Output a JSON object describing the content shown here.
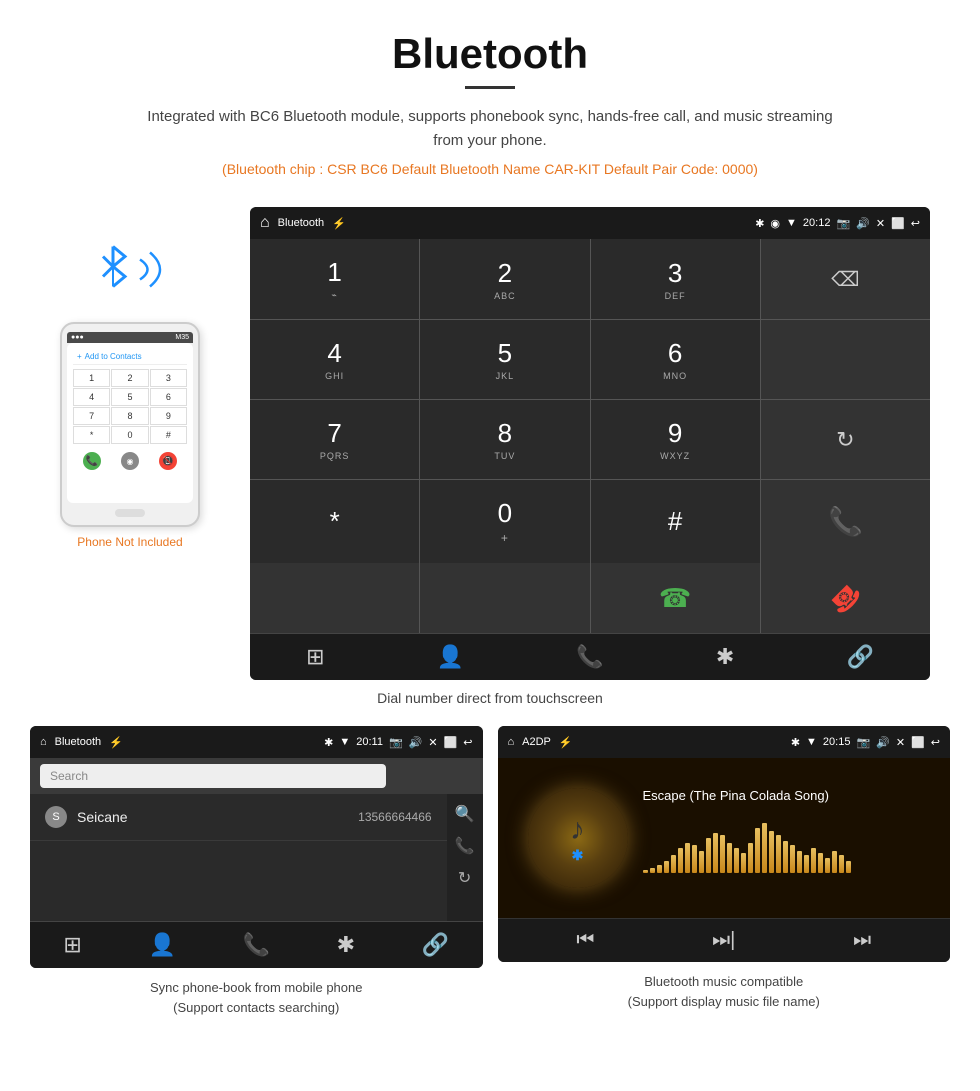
{
  "header": {
    "title": "Bluetooth",
    "subtitle": "Integrated with BC6 Bluetooth module, supports phonebook sync, hands-free call, and music streaming from your phone.",
    "info": "(Bluetooth chip : CSR BC6    Default Bluetooth Name CAR-KIT    Default Pair Code: 0000)"
  },
  "phone_label": "Phone Not Included",
  "dial_screen": {
    "status_bar": {
      "app_name": "Bluetooth",
      "time": "20:12"
    },
    "keys": [
      {
        "num": "1",
        "sub": ""
      },
      {
        "num": "2",
        "sub": "ABC"
      },
      {
        "num": "3",
        "sub": "DEF"
      },
      {
        "num": "",
        "sub": ""
      },
      {
        "num": "4",
        "sub": "GHI"
      },
      {
        "num": "5",
        "sub": "JKL"
      },
      {
        "num": "6",
        "sub": "MNO"
      },
      {
        "num": "",
        "sub": ""
      },
      {
        "num": "7",
        "sub": "PQRS"
      },
      {
        "num": "8",
        "sub": "TUV"
      },
      {
        "num": "9",
        "sub": "WXYZ"
      },
      {
        "num": "",
        "sub": ""
      },
      {
        "num": "*",
        "sub": ""
      },
      {
        "num": "0",
        "sub": "+"
      },
      {
        "num": "#",
        "sub": ""
      },
      {
        "num": "",
        "sub": ""
      },
      {
        "num": "",
        "sub": ""
      },
      {
        "num": "",
        "sub": ""
      },
      {
        "num": "",
        "sub": ""
      },
      {
        "num": "",
        "sub": ""
      }
    ],
    "caption": "Dial number direct from touchscreen"
  },
  "phonebook_screen": {
    "status_bar": {
      "app_name": "Bluetooth",
      "time": "20:11"
    },
    "search_placeholder": "Search",
    "contact": {
      "letter": "S",
      "name": "Seicane",
      "number": "13566664466"
    },
    "caption_line1": "Sync phone-book from mobile phone",
    "caption_line2": "(Support contacts searching)"
  },
  "music_screen": {
    "status_bar": {
      "app_name": "A2DP",
      "time": "20:15"
    },
    "song_title": "Escape (The Pina Colada Song)",
    "caption_line1": "Bluetooth music compatible",
    "caption_line2": "(Support display music file name)"
  },
  "visualizer_bars": [
    3,
    5,
    8,
    12,
    18,
    25,
    30,
    28,
    22,
    35,
    40,
    38,
    30,
    25,
    20,
    30,
    45,
    50,
    42,
    38,
    32,
    28,
    22,
    18,
    25,
    20,
    15,
    22,
    18,
    12
  ],
  "nav_icons": [
    "⊞",
    "👤",
    "📞",
    "✱",
    "🔗"
  ],
  "mini_keypad_keys": [
    "1",
    "2",
    "3",
    "4",
    "5",
    "6",
    "7",
    "8",
    "9",
    "*",
    "0",
    "#"
  ]
}
